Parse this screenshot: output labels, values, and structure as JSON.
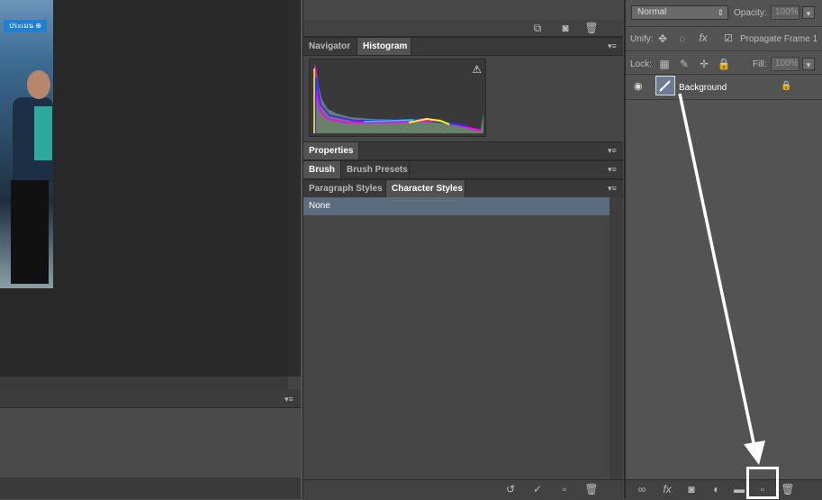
{
  "photo": {
    "sign_text": "ประเมน ⊕"
  },
  "panels": {
    "top_icons": [
      "new-state-icon",
      "camera-icon",
      "trash-icon"
    ],
    "navigator_group": {
      "tabs": [
        "Navigator",
        "Histogram"
      ],
      "active": "Histogram",
      "warning_glyph": "⚠"
    },
    "properties_group": {
      "tabs": [
        "Properties"
      ]
    },
    "brush_group": {
      "tabs": [
        "Brush",
        "Brush Presets"
      ]
    },
    "styles_group": {
      "tabs": [
        "Paragraph Styles",
        "Character Styles"
      ],
      "active": "Character Styles",
      "list": [
        "None"
      ]
    },
    "footer_icons": [
      "reset-icon",
      "commit-icon",
      "new-style-icon",
      "trash-icon"
    ]
  },
  "layers": {
    "blend_mode": "Normal",
    "opacity_label": "Opacity:",
    "opacity_value": "100%",
    "unify_label": "Unify:",
    "propagate_label": "Propagate Frame 1",
    "lock_label": "Lock:",
    "fill_label": "Fill:",
    "fill_value": "100%",
    "items": [
      {
        "name": "Background",
        "visible": true,
        "locked": true
      }
    ],
    "footer_icons": [
      "link-icon",
      "fx-icon",
      "mask-icon",
      "adjustment-icon",
      "folder-icon",
      "new-layer-icon",
      "trash-icon"
    ]
  },
  "glyphs": {
    "menu": "▾≡",
    "eye": "◉",
    "lock": "🔒",
    "chev": "⇕",
    "check": "☑",
    "fx": "fx"
  },
  "colors": {
    "selection": "#5b6c80",
    "panel": "#535353",
    "dark_panel": "#464646"
  }
}
